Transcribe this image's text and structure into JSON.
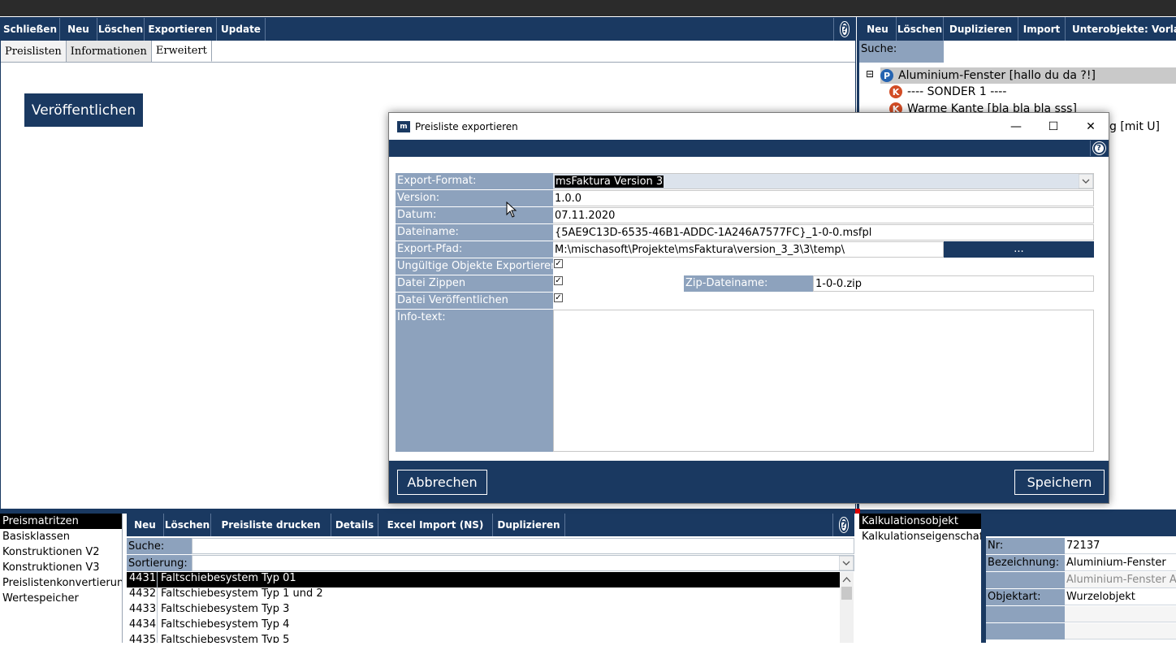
{
  "main_toolbar": {
    "buttons": [
      "Schließen",
      "Neu",
      "Löschen",
      "Exportieren",
      "Update"
    ],
    "help": "?"
  },
  "main_tabs": [
    "Preislisten",
    "Informationen",
    "Erweitert"
  ],
  "publish_button": "Veröffentlichen",
  "right_toolbar": {
    "buttons": [
      "Neu",
      "Löschen",
      "Duplizieren",
      "Import",
      "Unterobjekte: Vorlage ä"
    ]
  },
  "right_search_label": "Suche:",
  "tree": {
    "expander": "⊟",
    "nodes": [
      {
        "badge": "P",
        "text": "Aluminium-Fenster  [hallo du da ?!]"
      },
      {
        "badge": "K",
        "text": "----  SONDER 1  ----"
      },
      {
        "badge": "K",
        "text": "Warme Kante  [bla bla bla sss]"
      },
      {
        "badge": "",
        "text": "g  [mit U]"
      }
    ]
  },
  "bottom_left_list": [
    "Preismatritzen",
    "Basisklassen",
    "Konstruktionen V2",
    "Konstruktionen V3",
    "Preislistenkonvertierung",
    "Wertespeicher"
  ],
  "bottom_toolbar": {
    "buttons": [
      "Neu",
      "Löschen",
      "Preisliste drucken",
      "Details",
      "Excel Import (NS)",
      "Duplizieren"
    ],
    "help": "?"
  },
  "bottom_search_label": "Suche:",
  "bottom_sort_label": "Sortierung:",
  "bottom_rows": [
    {
      "num": "4431",
      "name": "Faltschiebesystem Typ 01"
    },
    {
      "num": "4432",
      "name": "Faltschiebesystem Typ 1 und 2"
    },
    {
      "num": "4433",
      "name": "Faltschiebesystem Typ 3"
    },
    {
      "num": "4434",
      "name": "Faltschiebesystem Typ 4"
    },
    {
      "num": "4435",
      "name": "Faltschiebesystem Typ 5"
    }
  ],
  "kalk_list": [
    "Kalkulationsobjekt",
    "Kalkulationseigenschaften"
  ],
  "kalk_fields": [
    {
      "label": "Nr:",
      "value": "72137"
    },
    {
      "label": "Bezeichnung:",
      "value": "Aluminium-Fenster"
    },
    {
      "label": "",
      "value": "Aluminium-Fenster Al"
    },
    {
      "label": "Objektart:",
      "value": "Wurzelobjekt"
    },
    {
      "label": "",
      "value": ""
    },
    {
      "label": "",
      "value": ""
    }
  ],
  "dialog": {
    "title": "Preisliste exportieren",
    "logo": "m",
    "minimize": "—",
    "maximize": "☐",
    "close": "✕",
    "help": "?",
    "fields": {
      "format_label": "Export-Format:",
      "format_value": "msFaktura Version 3",
      "version_label": "Version:",
      "version_value": "1.0.0",
      "date_label": "Datum:",
      "date_value": "07.11.2020",
      "filename_label": "Dateiname:",
      "filename_value": "{5AE9C13D-6535-46B1-ADDC-1A246A7577FC}_1-0-0.msfpl",
      "path_label": "Export-Pfad:",
      "path_value": "M:\\mischasoft\\Projekte\\msFaktura\\version_3_3\\3\\temp\\",
      "browse": "...",
      "invalid_label": "Ungültige Objekte Exportieren",
      "zip_label": "Datei Zippen",
      "zipname_label": "Zip-Dateiname:",
      "zipname_value": "1-0-0.zip",
      "publish_label": "Datei Veröffentlichen",
      "info_label": "Info-text:"
    },
    "cancel": "Abbrechen",
    "save": "Speichern"
  },
  "colors": {
    "navy": "#1a3961",
    "label_blue": "#8da2bd",
    "badge_p": "#2563b0",
    "badge_k": "#d24c25"
  }
}
